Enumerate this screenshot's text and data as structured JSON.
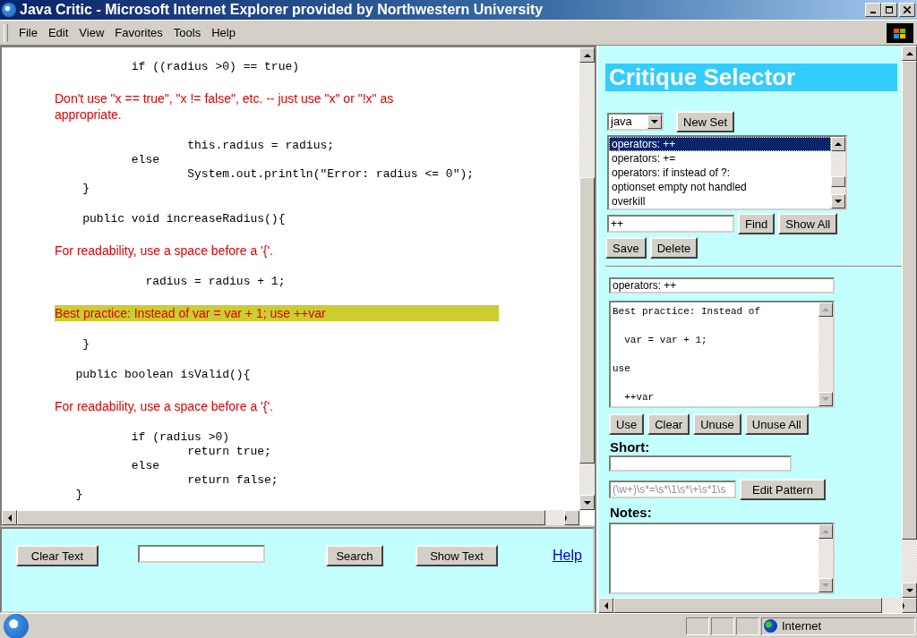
{
  "window": {
    "title": "Java Critic - Microsoft Internet Explorer provided by Northwestern University"
  },
  "menu": [
    "File",
    "Edit",
    "View",
    "Favorites",
    "Tools",
    "Help"
  ],
  "code_view": {
    "blocks": [
      {
        "kind": "code",
        "lines": [
          "           if ((radius >0) == true)"
        ]
      },
      {
        "kind": "critique",
        "text": "Don't use \"x == true\", \"x != false\", etc. -- just use \"x\" or \"!x\" as appropriate.",
        "highlighted": false
      },
      {
        "kind": "code",
        "lines": [
          "                   this.radius = radius;",
          "           else",
          "                   System.out.println(\"Error: radius <= 0\");",
          "    }"
        ]
      },
      {
        "kind": "code",
        "lines": [
          "    public void increaseRadius(){"
        ]
      },
      {
        "kind": "critique",
        "text": "For readability, use a space before a '{'.",
        "highlighted": false
      },
      {
        "kind": "code",
        "lines": [
          "             radius = radius + 1;"
        ]
      },
      {
        "kind": "critique",
        "text": "Best practice: Instead of var = var + 1; use ++var",
        "highlighted": true
      },
      {
        "kind": "code",
        "lines": [
          "    }"
        ]
      },
      {
        "kind": "code",
        "lines": [
          "   public boolean isValid(){"
        ]
      },
      {
        "kind": "critique",
        "text": "For readability, use a space before a '{'.",
        "highlighted": false
      },
      {
        "kind": "code",
        "lines": [
          "           if (radius >0)",
          "                   return true;",
          "           else",
          "                   return false;",
          "   }"
        ]
      }
    ]
  },
  "bottom_bar": {
    "clear_button": "Clear Text",
    "search_button": "Search",
    "show_button": "Show Text",
    "help_link": "Help"
  },
  "selector": {
    "heading": "Critique Selector",
    "set": "java",
    "new_set_button": "New Set",
    "critiques": [
      {
        "label": "operators: ++",
        "selected": true
      },
      {
        "label": "operators: +=",
        "selected": false
      },
      {
        "label": "operators: if instead of ?:",
        "selected": false
      },
      {
        "label": "optionset empty not handled",
        "selected": false
      },
      {
        "label": "overkill",
        "selected": false
      }
    ],
    "find_value": "++",
    "find_button": "Find",
    "show_all_button": "Show All",
    "save_button": "Save",
    "delete_button": "Delete",
    "name_value": "operators: ++",
    "critique_text": "Best practice: Instead of\n\n  var = var + 1;\n\nuse\n\n  ++var",
    "action_buttons": [
      "Use",
      "Clear",
      "Unuse",
      "Unuse All"
    ],
    "short_label": "Short:",
    "pattern_value": "(\\w+)\\s*=\\s*\\1\\s*\\+\\s*1\\s",
    "pattern_disabled": true,
    "edit_pattern_button": "Edit Pattern",
    "notes_label": "Notes:"
  },
  "status_bar": {
    "zone": "Internet"
  }
}
